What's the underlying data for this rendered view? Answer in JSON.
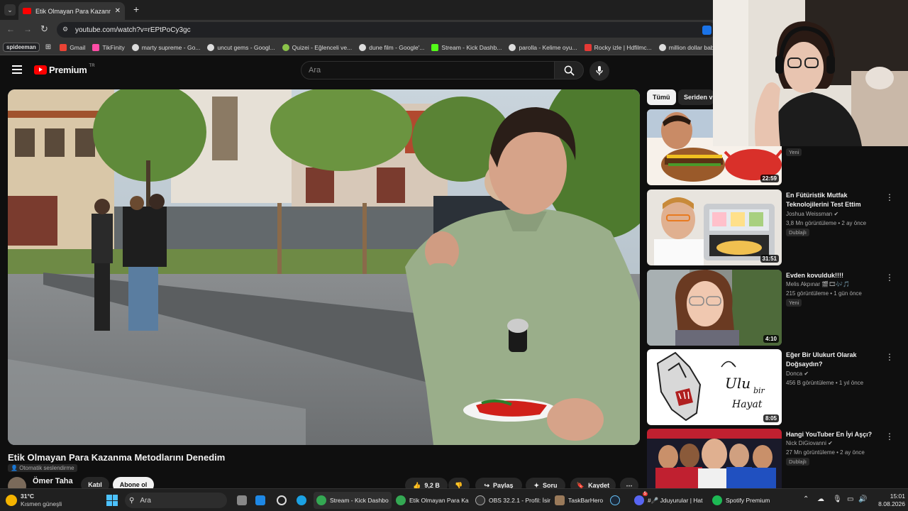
{
  "browser": {
    "tab_title": "Etik Olmayan Para Kazanma Me...",
    "url": "youtube.com/watch?v=rEPtPoCy3gc",
    "profile_label": "spideeman",
    "bookmarks": [
      "Gmail",
      "TikFinity",
      "marty supreme - Go...",
      "uncut gems - Googl...",
      "Quizei - Eğlenceli ve...",
      "dune film - Google'...",
      "Stream - Kick Dashb...",
      "parolla - Kelime oyu...",
      "Rocky izle | Hdfilmc...",
      "million dollar baby -..."
    ]
  },
  "youtube": {
    "logo": "Premium",
    "logo_region": "TR",
    "search_placeholder": "Ara",
    "video_title": "Etik Olmayan Para Kazanma Metodlarını Denedim",
    "auto_dub": "Otomatik seslendirme",
    "channel": "Ömer Taha",
    "join_label": "Katıl",
    "subscribe_label": "Abone ol",
    "likes": "9,2 B",
    "share_label": "Paylaş",
    "ask_label": "Soru",
    "save_label": "Kaydet",
    "chips": [
      "Tümü",
      "Seriden vi"
    ],
    "recommendations": [
      {
        "title": "",
        "channel": "",
        "meta": "",
        "badge": "Yeni",
        "duration": "22:59"
      },
      {
        "title": "En Fütüristik Mutfak Teknolojilerini Test Ettim",
        "channel": "Joshua Weissman",
        "meta": "3,8 Mn görüntüleme • 2 ay önce",
        "badge": "Dublajlı",
        "duration": "31:51"
      },
      {
        "title": "Evden kovulduk!!!!",
        "channel": "Melis Akpınar 🎬🎞🎶🎵",
        "meta": "215 görüntüleme • 1 gün önce",
        "badge": "Yeni",
        "duration": "4:10"
      },
      {
        "title": "Eğer Bir Ulukurt Olarak Doğsaydın?",
        "channel": "Donca",
        "meta": "456 B görüntüleme • 1 yıl önce",
        "badge": "",
        "duration": "8:05"
      },
      {
        "title": "Hangi YouTuber En İyi Aşçı?",
        "channel": "Nick DiGiovanni",
        "meta": "27 Mn görüntüleme • 2 ay önce",
        "badge": "Dublajlı",
        "duration": ""
      }
    ],
    "thumb4_text": {
      "line1": "Ulu",
      "line2": "bir",
      "line3": "Hayat"
    }
  },
  "taskbar": {
    "weather_temp": "31°C",
    "weather_desc": "Kısmen güneşli",
    "search_placeholder": "Ara",
    "apps": [
      "Stream - Kick Dashbo",
      "Etik Olmayan Para Ka",
      "OBS 32.2.1 - Profil: İsir",
      "TaskBarHero",
      "#🎤 Jduyurular | Hat",
      "Spotify Premium"
    ],
    "discord_badge": "5",
    "time": "15:01",
    "date": "8.08.2026"
  },
  "colors": {
    "yt_red": "#ff0000",
    "bg": "#0f0f0f",
    "chip_active": "#f1f1f1"
  }
}
